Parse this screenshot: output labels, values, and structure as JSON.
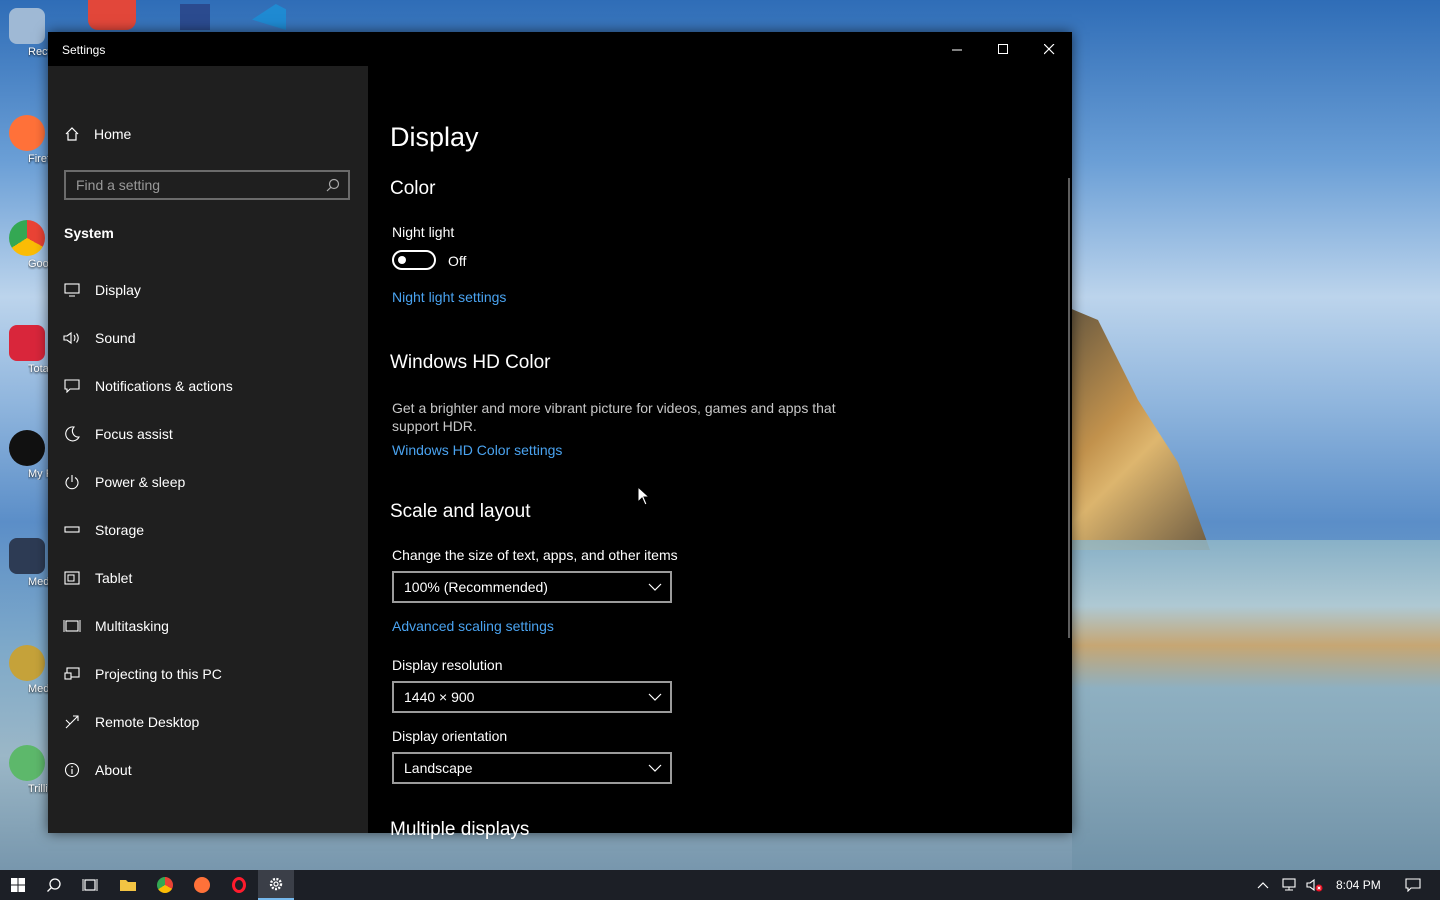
{
  "desktop": {
    "icons": [
      {
        "label": "Recycle",
        "color": "#9fb9d5"
      },
      {
        "label": "Firefo",
        "color": "#ff7139"
      },
      {
        "label": "Googl Chron",
        "color": "#34a853"
      },
      {
        "label": "TotalA",
        "color": "#d9263b"
      },
      {
        "label": "My Frie Pingi",
        "color": "#111111"
      },
      {
        "label": "Media P Classic",
        "color": "#2d3b54"
      },
      {
        "label": "MediaM",
        "color": "#c5a23a"
      },
      {
        "label": "Trillia",
        "color": "#5db86b"
      }
    ]
  },
  "window": {
    "title": "Settings",
    "minimize_icon": "minimize-icon",
    "maximize_icon": "maximize-icon",
    "close_icon": "close-icon"
  },
  "sidebar": {
    "home_label": "Home",
    "search_placeholder": "Find a setting",
    "section_title": "System",
    "items": [
      {
        "label": "Display",
        "icon": "monitor-icon"
      },
      {
        "label": "Sound",
        "icon": "speaker-icon"
      },
      {
        "label": "Notifications & actions",
        "icon": "notification-icon"
      },
      {
        "label": "Focus assist",
        "icon": "moon-icon"
      },
      {
        "label": "Power & sleep",
        "icon": "power-icon"
      },
      {
        "label": "Storage",
        "icon": "storage-icon"
      },
      {
        "label": "Tablet",
        "icon": "tablet-icon"
      },
      {
        "label": "Multitasking",
        "icon": "multitasking-icon"
      },
      {
        "label": "Projecting to this PC",
        "icon": "projector-icon"
      },
      {
        "label": "Remote Desktop",
        "icon": "remote-desktop-icon"
      },
      {
        "label": "About",
        "icon": "info-icon"
      }
    ]
  },
  "content": {
    "page_title": "Display",
    "color": {
      "heading": "Color",
      "night_light_label": "Night light",
      "night_light_state": "Off",
      "night_light_link": "Night light settings"
    },
    "hdr": {
      "heading": "Windows HD Color",
      "description": "Get a brighter and more vibrant picture for videos, games and apps that support HDR.",
      "link": "Windows HD Color settings"
    },
    "scale": {
      "heading": "Scale and layout",
      "size_label": "Change the size of text, apps, and other items",
      "size_value": "100% (Recommended)",
      "advanced_link": "Advanced scaling settings",
      "resolution_label": "Display resolution",
      "resolution_value": "1440 × 900",
      "orientation_label": "Display orientation",
      "orientation_value": "Landscape"
    },
    "multiple_heading": "Multiple displays"
  },
  "taskbar": {
    "clock": "8:04 PM",
    "accent": "#76b9ed"
  }
}
